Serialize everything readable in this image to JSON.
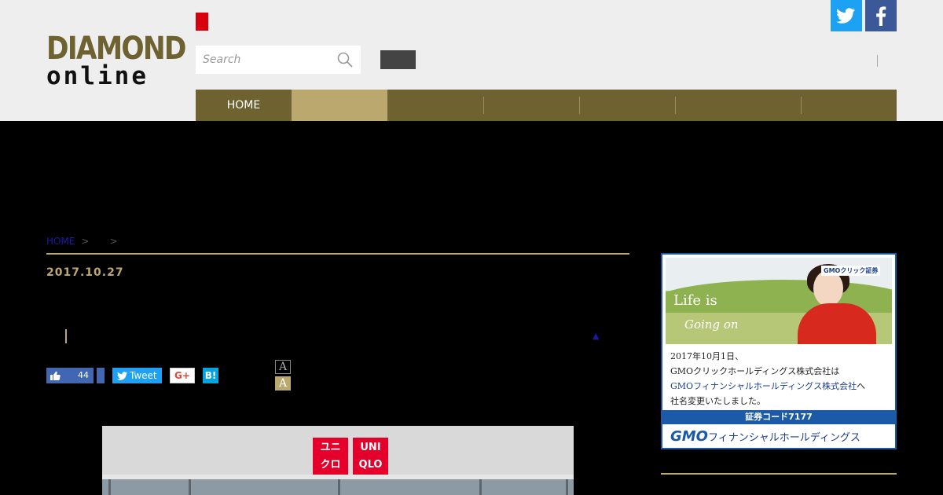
{
  "header": {
    "logo_line1": "DIAMOND",
    "logo_line2": "online",
    "search_placeholder": "Search"
  },
  "nav": {
    "items": [
      {
        "label": "HOME",
        "active": false
      },
      {
        "label": "",
        "active": true
      },
      {
        "label": "",
        "active": false
      },
      {
        "label": "",
        "active": false
      },
      {
        "label": "",
        "active": false
      },
      {
        "label": "",
        "active": false
      },
      {
        "label": "",
        "active": false
      }
    ]
  },
  "breadcrumb": {
    "home": "HOME",
    "separator": ">"
  },
  "article": {
    "date": "2017.10.27"
  },
  "share": {
    "like_count": "44",
    "tweet_label": "Tweet",
    "gplus_label": "G+",
    "hatena_label": "B!",
    "font_size_a1": "A",
    "font_size_a2": "A"
  },
  "photo": {
    "logo_left_line1": "ユニ",
    "logo_left_line2": "クロ",
    "logo_right_line1": "UNI",
    "logo_right_line2": "QLO"
  },
  "ad": {
    "brand_tag": "GMOクリック証券",
    "headline1": "Life is",
    "headline2": "Going on",
    "text_line1": "2017年10月1日、",
    "text_line2": "GMOクリックホールディングス株式会社は",
    "text_line3_highlight": "GMOフィナンシャルホールディングス株式会社",
    "text_line3_suffix": "へ",
    "text_line4": "社名変更いたしました。",
    "code_label": "証券コード7177",
    "footer_brand": "GMO",
    "footer_rest": "フィナンシャルホールディングス"
  },
  "colors": {
    "header_bg": "#eeeeee",
    "nav_bg": "#6e6230",
    "nav_active": "#baa86f",
    "gold": "#baa86f",
    "twitter": "#1da1f2",
    "facebook": "#3b5998"
  },
  "icons": {
    "search": "magnifier-icon",
    "twitter": "twitter-bird-icon",
    "facebook": "facebook-f-icon",
    "like": "thumbs-up-icon"
  }
}
